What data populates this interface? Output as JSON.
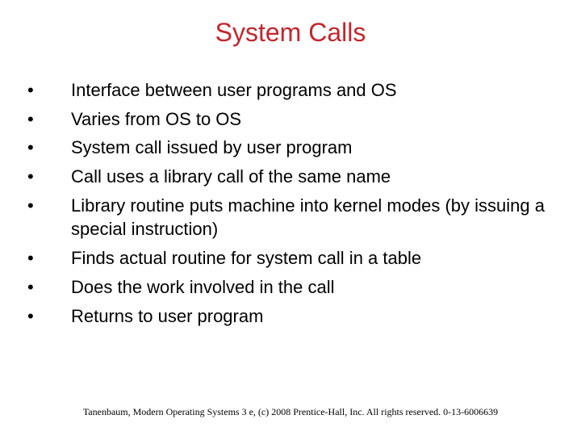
{
  "title": "System Calls",
  "bullets": [
    "Interface between user programs and OS",
    "Varies from OS to OS",
    "System call issued by user program",
    "Call uses a library call of the same name",
    "Library routine puts machine into kernel modes (by issuing a special instruction)",
    "Finds actual routine for system call in a table",
    "Does the work involved in the call",
    "Returns to user program"
  ],
  "footer": "Tanenbaum, Modern Operating Systems 3 e, (c) 2008 Prentice-Hall, Inc. All rights reserved. 0-13-6006639"
}
